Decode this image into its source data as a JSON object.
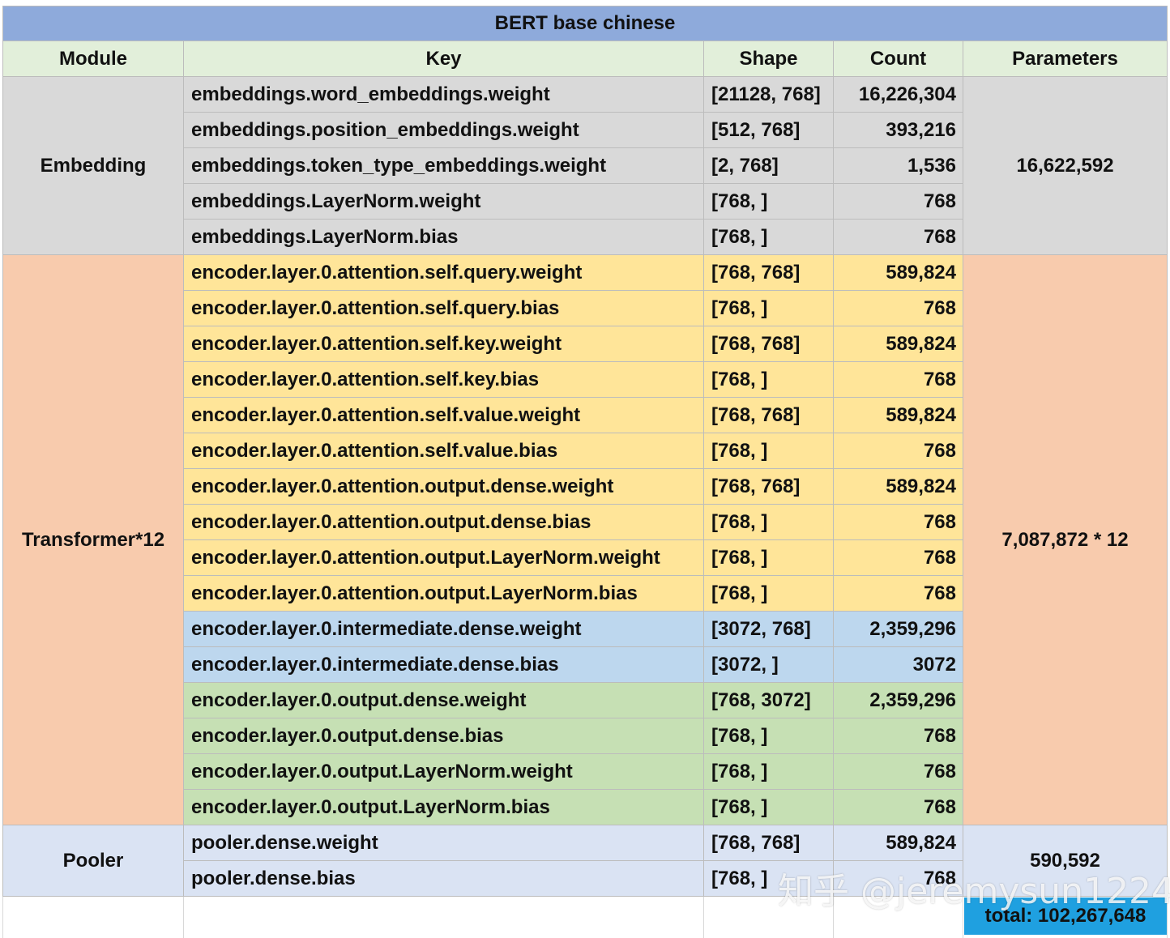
{
  "title": "BERT base chinese",
  "headers": {
    "module": "Module",
    "key": "Key",
    "shape": "Shape",
    "count": "Count",
    "parameters": "Parameters"
  },
  "colors": {
    "title_bg": "#8eaadb",
    "header_bg": "#e2efda",
    "embedding_bg": "#d9d9d9",
    "transformer_bg": "#f8cbad",
    "attention_bg": "#ffe599",
    "intermediate_bg": "#bdd7ee",
    "output_bg": "#c6e0b4",
    "pooler_bg": "#dae3f3",
    "total_bg": "#1fa0e0"
  },
  "groups": [
    {
      "module": "Embedding",
      "parameters": "16,622,592",
      "rows": [
        {
          "key": "embeddings.word_embeddings.weight",
          "shape": "[21128, 768]",
          "count": "16,226,304",
          "band": "embedding"
        },
        {
          "key": "embeddings.position_embeddings.weight",
          "shape": "[512, 768]",
          "count": "393,216",
          "band": "embedding"
        },
        {
          "key": "embeddings.token_type_embeddings.weight",
          "shape": "[2, 768]",
          "count": "1,536",
          "band": "embedding"
        },
        {
          "key": "embeddings.LayerNorm.weight",
          "shape": "[768, ]",
          "count": "768",
          "band": "embedding"
        },
        {
          "key": "embeddings.LayerNorm.bias",
          "shape": "[768, ]",
          "count": "768",
          "band": "embedding"
        }
      ]
    },
    {
      "module": "Transformer*12",
      "parameters": "7,087,872 * 12",
      "rows": [
        {
          "key": "encoder.layer.0.attention.self.query.weight",
          "shape": "[768, 768]",
          "count": "589,824",
          "band": "attention"
        },
        {
          "key": "encoder.layer.0.attention.self.query.bias",
          "shape": "[768, ]",
          "count": "768",
          "band": "attention"
        },
        {
          "key": "encoder.layer.0.attention.self.key.weight",
          "shape": "[768, 768]",
          "count": "589,824",
          "band": "attention"
        },
        {
          "key": "encoder.layer.0.attention.self.key.bias",
          "shape": "[768, ]",
          "count": "768",
          "band": "attention"
        },
        {
          "key": "encoder.layer.0.attention.self.value.weight",
          "shape": "[768, 768]",
          "count": "589,824",
          "band": "attention"
        },
        {
          "key": "encoder.layer.0.attention.self.value.bias",
          "shape": "[768, ]",
          "count": "768",
          "band": "attention"
        },
        {
          "key": "encoder.layer.0.attention.output.dense.weight",
          "shape": "[768, 768]",
          "count": "589,824",
          "band": "attention"
        },
        {
          "key": "encoder.layer.0.attention.output.dense.bias",
          "shape": "[768, ]",
          "count": "768",
          "band": "attention"
        },
        {
          "key": "encoder.layer.0.attention.output.LayerNorm.weight",
          "shape": "[768, ]",
          "count": "768",
          "band": "attention"
        },
        {
          "key": "encoder.layer.0.attention.output.LayerNorm.bias",
          "shape": "[768, ]",
          "count": "768",
          "band": "attention"
        },
        {
          "key": "encoder.layer.0.intermediate.dense.weight",
          "shape": "[3072, 768]",
          "count": "2,359,296",
          "band": "intermediate"
        },
        {
          "key": "encoder.layer.0.intermediate.dense.bias",
          "shape": "[3072, ]",
          "count": "3072",
          "band": "intermediate"
        },
        {
          "key": "encoder.layer.0.output.dense.weight",
          "shape": "[768, 3072]",
          "count": "2,359,296",
          "band": "output"
        },
        {
          "key": "encoder.layer.0.output.dense.bias",
          "shape": "[768, ]",
          "count": "768",
          "band": "output"
        },
        {
          "key": "encoder.layer.0.output.LayerNorm.weight",
          "shape": "[768, ]",
          "count": "768",
          "band": "output"
        },
        {
          "key": "encoder.layer.0.output.LayerNorm.bias",
          "shape": "[768, ]",
          "count": "768",
          "band": "output"
        }
      ]
    },
    {
      "module": "Pooler",
      "parameters": "590,592",
      "rows": [
        {
          "key": "pooler.dense.weight",
          "shape": "[768, 768]",
          "count": "589,824",
          "band": "pooler"
        },
        {
          "key": "pooler.dense.bias",
          "shape": "[768, ]",
          "count": "768",
          "band": "pooler"
        }
      ]
    }
  ],
  "total": "total: 102,267,648",
  "watermark": "知乎 @jeremysun1224"
}
